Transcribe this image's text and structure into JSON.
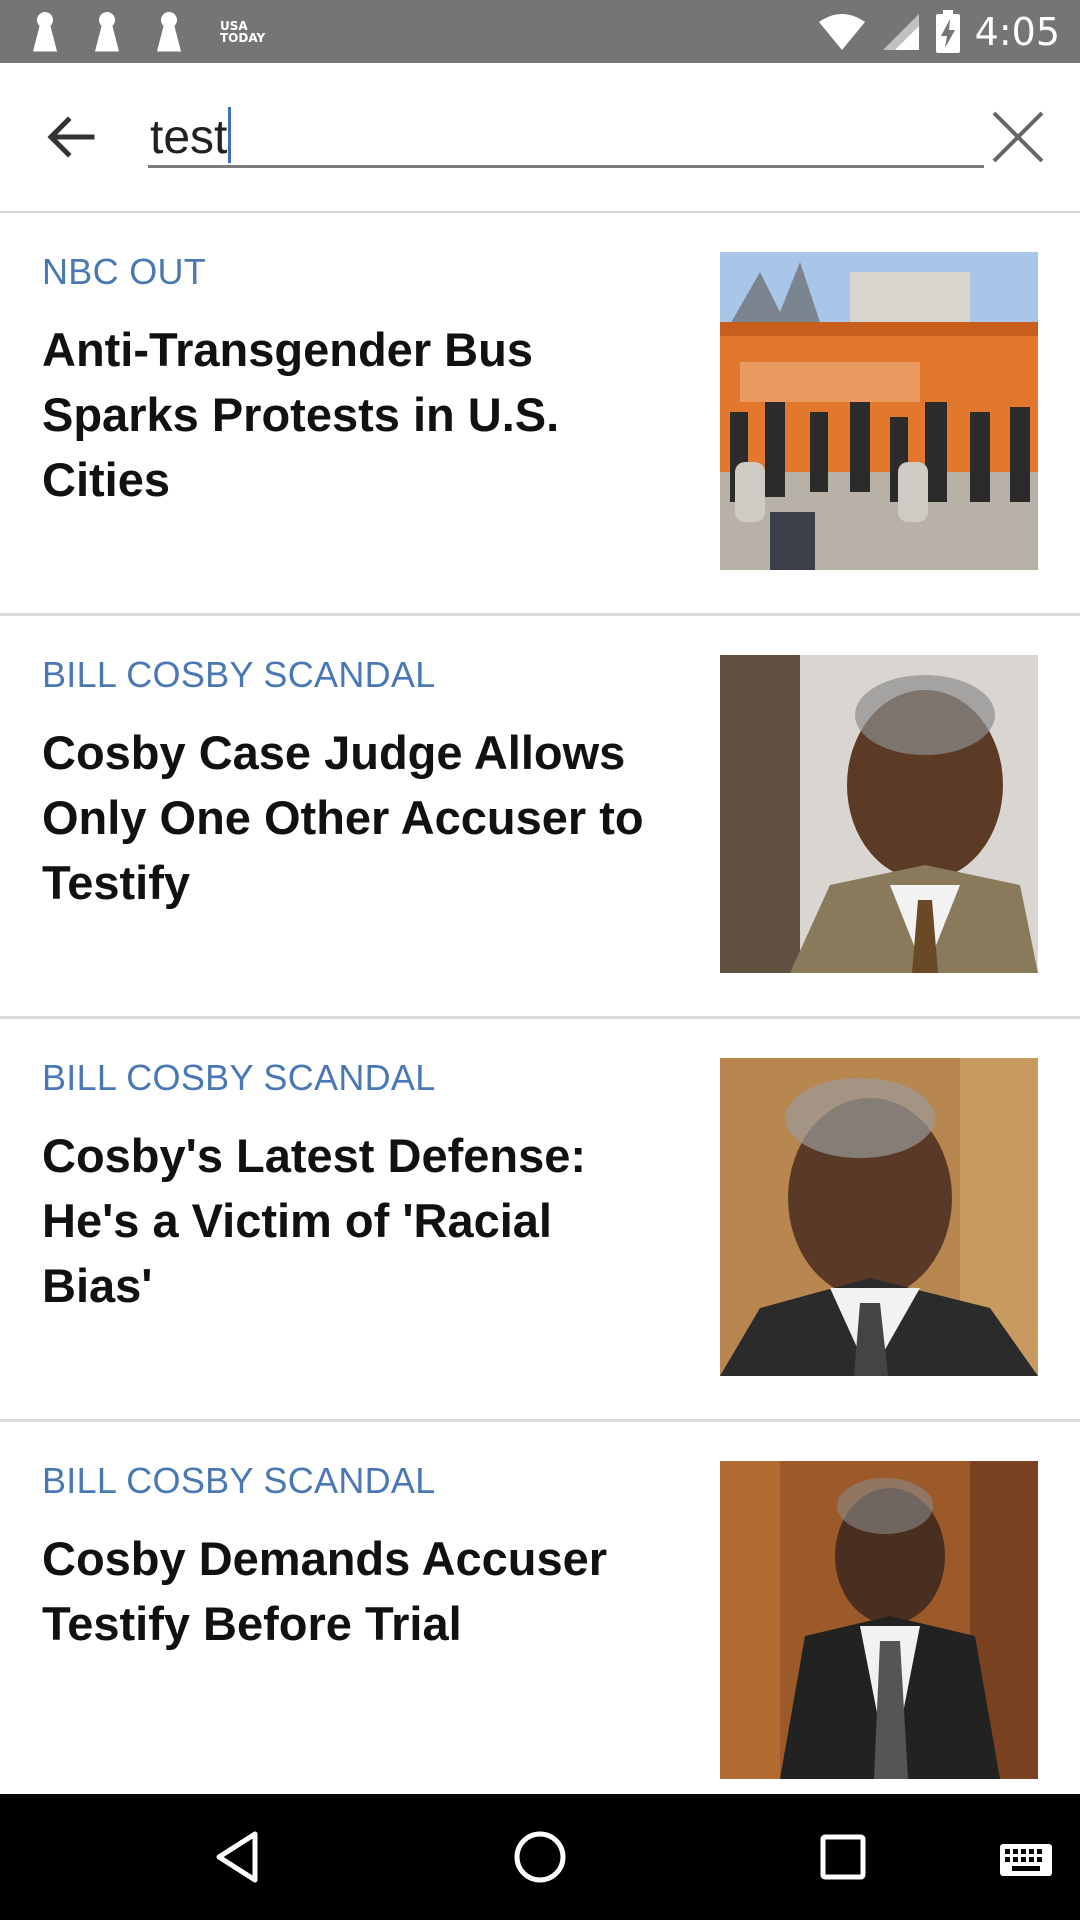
{
  "status_bar": {
    "time": "4:05",
    "app_badge": [
      "USA",
      "TODAY"
    ],
    "icons": [
      "notification-pin-icon",
      "notification-pin-icon",
      "notification-pin-icon",
      "wifi-icon",
      "signal-icon",
      "battery-charging-icon"
    ]
  },
  "search": {
    "value": "test",
    "back_icon": "arrow-left-icon",
    "clear_icon": "close-icon"
  },
  "articles": [
    {
      "category": "NBC OUT",
      "headline": "Anti-Transgender Bus Sparks Protests in U.S. Cities"
    },
    {
      "category": "BILL COSBY SCANDAL",
      "headline": "Cosby Case Judge Allows Only One Other Accuser to Testify"
    },
    {
      "category": "BILL COSBY SCANDAL",
      "headline": "Cosby's Latest Defense: He's a Victim of 'Racial Bias'"
    },
    {
      "category": "BILL COSBY SCANDAL",
      "headline": "Cosby Demands Accuser Testify Before Trial"
    }
  ],
  "nav_bar": {
    "icons": [
      "back-triangle-icon",
      "home-circle-icon",
      "recents-square-icon",
      "keyboard-icon"
    ]
  },
  "colors": {
    "category_blue": "#4a78b4",
    "status_bar": "#757575",
    "caret": "#3f6fb7"
  }
}
